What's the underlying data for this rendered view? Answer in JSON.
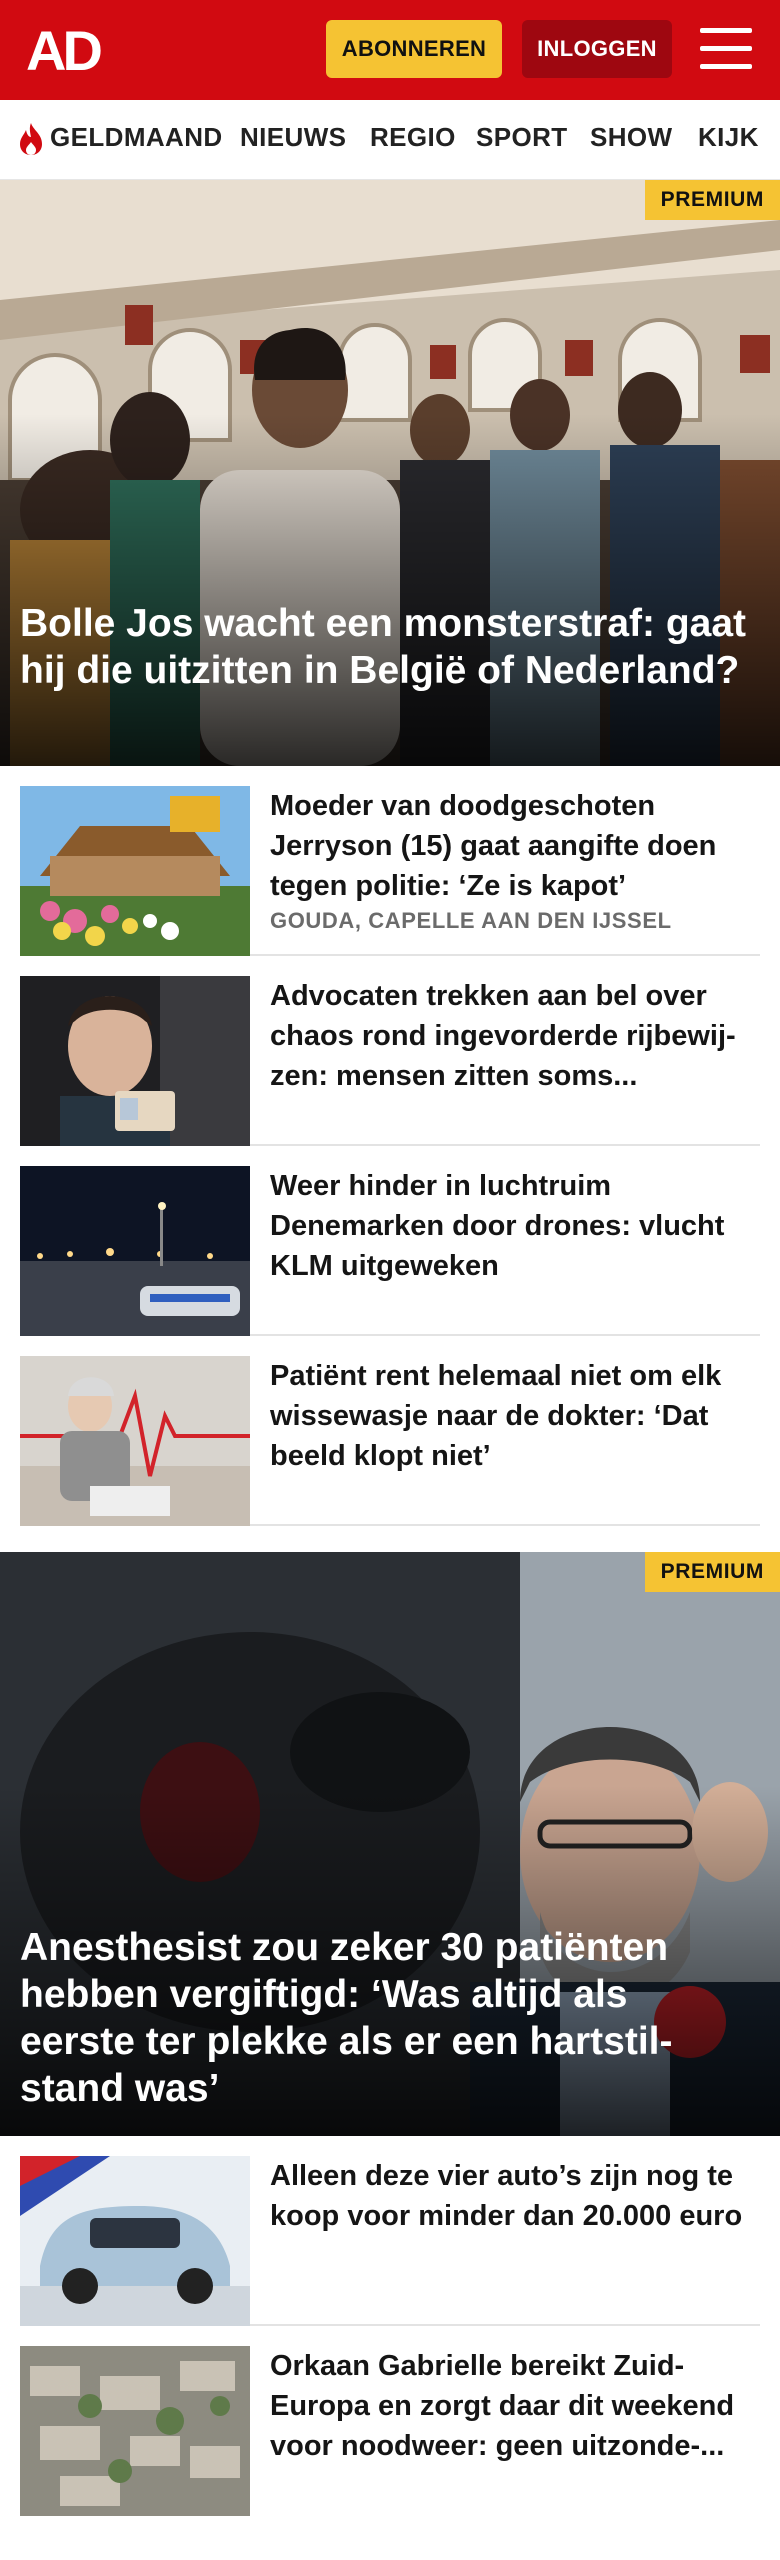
{
  "header": {
    "logo_text": "AD",
    "subscribe_label": "ABONNEREN",
    "login_label": "INLOGGEN",
    "menu_icon": "hamburger-menu-icon",
    "brand_color": "#d10a11"
  },
  "nav": {
    "items": [
      "GELDMAAND",
      "NIEUWS",
      "REGIO",
      "SPORT",
      "SHOW",
      "KIJK"
    ],
    "highlight_icon": "flame-icon"
  },
  "hero1": {
    "badge": "PREMIUM",
    "title": "Bolle Jos wacht een monsterstraf: gaat hij die uitzitten in België of Nederland?"
  },
  "articles1": [
    {
      "title": "Moeder van doodgeschoten Jerryson (15) gaat aangifte doen tegen politie: ‘Ze is kapot’",
      "location": "GOUDA, CAPELLE AAN DEN IJSSEL"
    },
    {
      "title": "Advocaten trekken aan bel over chaos rond ingevorderde rijbewij­zen: mensen zitten soms..."
    },
    {
      "title": "Weer hinder in luchtruim Denemarken door drones: vlucht KLM uitgeweken"
    },
    {
      "title": "Patiënt rent helemaal niet om elk wissewasje naar de dokter: ‘Dat beeld klopt niet’"
    }
  ],
  "hero2": {
    "badge": "PREMIUM",
    "title": "Anesthesist zou zeker 30 patiënten hebben vergiftigd: ‘Was altijd als eerste ter plekke als er een hartstil­stand was’"
  },
  "articles2": [
    {
      "title": "Alleen deze vier auto’s zijn nog te koop voor minder dan 20.000 euro"
    },
    {
      "title": "Orkaan Gabrielle bereikt Zuid-Europa en zorgt daar dit weekend voor noodweer: geen uitzonde-..."
    }
  ]
}
